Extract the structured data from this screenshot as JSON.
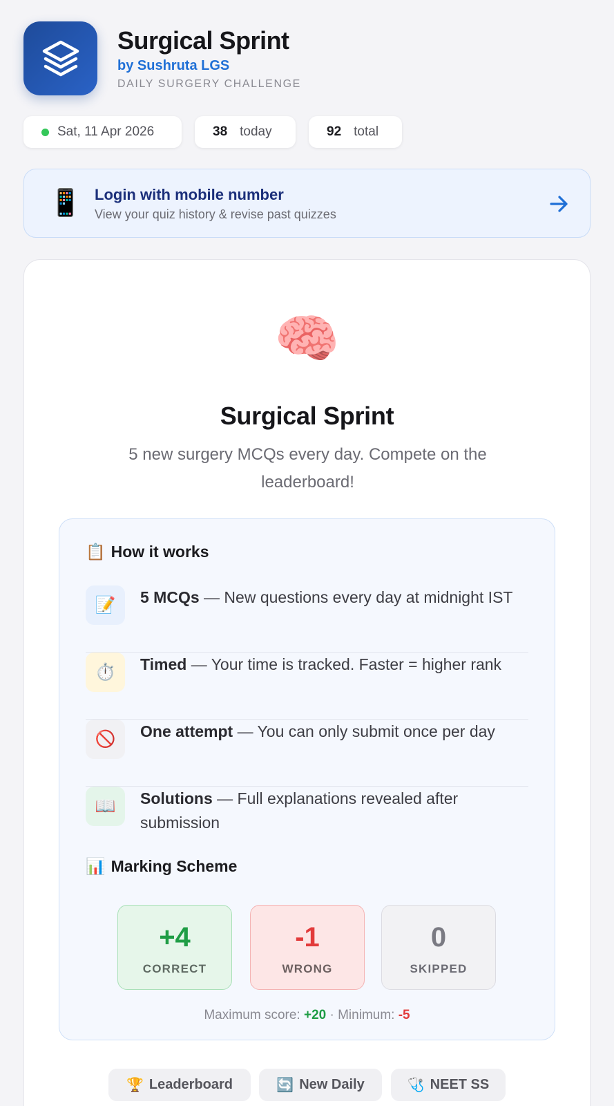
{
  "header": {
    "app_title": "Surgical Sprint",
    "byline": "by Sushruta LGS",
    "tagline": "DAILY SURGERY CHALLENGE",
    "app_icon": "layers-icon"
  },
  "stats": {
    "date": "Sat, 11 Apr 2026",
    "today_count": "38",
    "today_label": "today",
    "total_count": "92",
    "total_label": "total",
    "status_color": "#34c759"
  },
  "login": {
    "icon": "📱",
    "title": "Login with mobile number",
    "subtitle": "View your quiz history & revise past quizzes",
    "arrow": "→"
  },
  "intro": {
    "emoji": "🧠",
    "title": "Surgical Sprint",
    "description": "5 new surgery MCQs every day. Compete on the leaderboard!"
  },
  "how_it_works": {
    "icon": "📋",
    "heading": "How it works",
    "rules": [
      {
        "icon": "📝",
        "title": "5 MCQs",
        "text": " — New questions every day at midnight IST"
      },
      {
        "icon": "⏱️",
        "title": "Timed",
        "text": " — Your time is tracked. Faster = higher rank"
      },
      {
        "icon": "🚫",
        "title": "One attempt",
        "text": " — You can only submit once per day"
      },
      {
        "icon": "📖",
        "title": "Solutions",
        "text": " — Full explanations revealed after submission"
      }
    ]
  },
  "marking": {
    "icon": "📊",
    "heading": "Marking Scheme",
    "correct": {
      "value": "+4",
      "label": "CORRECT"
    },
    "wrong": {
      "value": "-1",
      "label": "WRONG"
    },
    "skipped": {
      "value": "0",
      "label": "SKIPPED"
    },
    "max_label": "Maximum score:",
    "max_value": "+20",
    "separator": "·",
    "min_label": "Minimum:",
    "min_value": "-5"
  },
  "footer_chips": [
    {
      "icon": "🏆",
      "label": "Leaderboard"
    },
    {
      "icon": "🔄",
      "label": "New Daily"
    },
    {
      "icon": "🩺",
      "label": "NEET SS"
    }
  ]
}
